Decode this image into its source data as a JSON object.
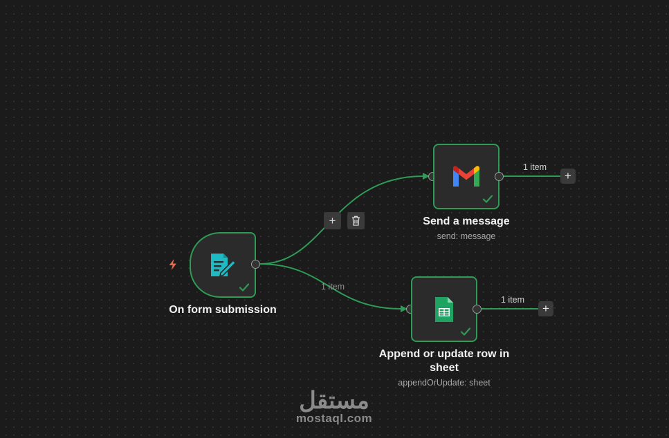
{
  "nodes": {
    "trigger": {
      "title": "On form submission",
      "icon": "form-edit-icon"
    },
    "gmail": {
      "title": "Send a message",
      "subtitle": "send: message",
      "icon": "gmail-icon"
    },
    "sheets": {
      "title": "Append or update row in sheet",
      "subtitle": "appendOrUpdate: sheet",
      "icon": "google-sheets-icon"
    }
  },
  "edges": {
    "trigger_to_sheets_label": "1 item",
    "gmail_output_label": "1 item",
    "sheets_output_label": "1 item"
  },
  "toolbar": {
    "add_label": "+",
    "delete_icon": "trash-icon"
  },
  "output_add_label": "+",
  "watermark": {
    "logo": "مستقل",
    "text": "mostaql.com"
  },
  "colors": {
    "background": "#1b1b1b",
    "node_border": "#2e9c56",
    "edge": "#2e9c56",
    "trigger_icon": "#1fb9c4",
    "bolt": "#e8694a"
  }
}
